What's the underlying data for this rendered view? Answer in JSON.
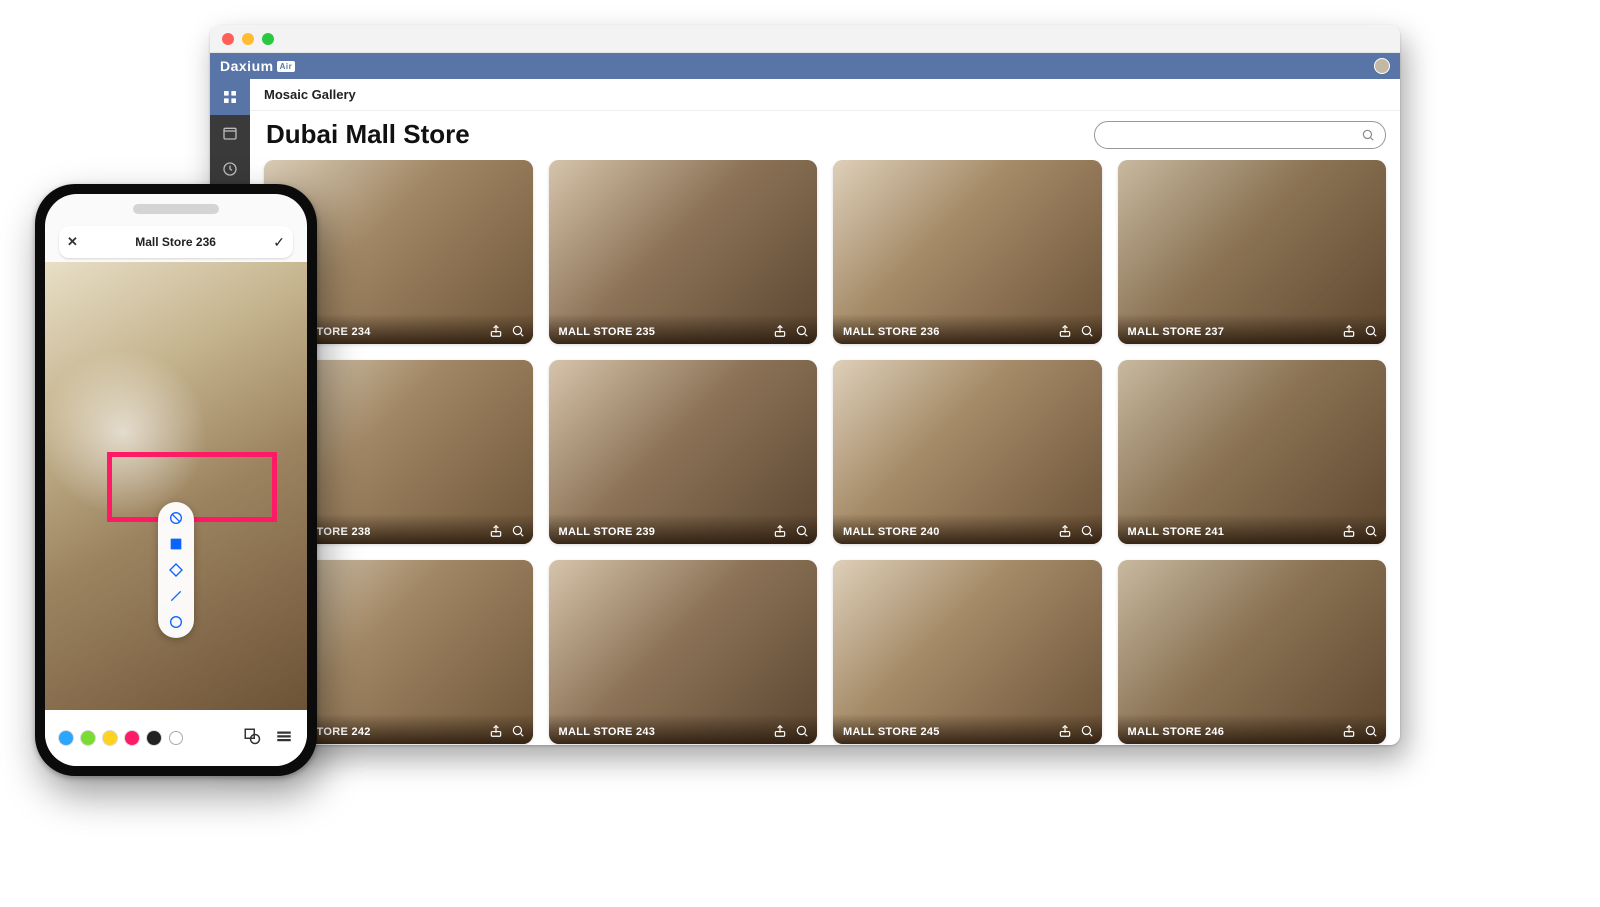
{
  "window": {
    "brand": "Daxium",
    "brand_suffix": "Air",
    "breadcrumb": "Mosaic Gallery",
    "page_title": "Dubai Mall Store"
  },
  "sidebar": {
    "items": [
      {
        "name": "apps-grid-icon",
        "active": true
      },
      {
        "name": "calendar-icon",
        "active": false
      },
      {
        "name": "clock-icon",
        "active": false
      }
    ]
  },
  "gallery": {
    "cards": [
      {
        "label": "MALL STORE 234"
      },
      {
        "label": "MALL STORE 235"
      },
      {
        "label": "MALL STORE 236"
      },
      {
        "label": "MALL STORE 237"
      },
      {
        "label": "MALL STORE 238"
      },
      {
        "label": "MALL STORE 239"
      },
      {
        "label": "MALL STORE 240"
      },
      {
        "label": "MALL STORE 241"
      },
      {
        "label": "MALL STORE 242"
      },
      {
        "label": "MALL STORE 243"
      },
      {
        "label": "MALL STORE 245"
      },
      {
        "label": "MALL STORE 246"
      }
    ]
  },
  "phone": {
    "title": "Mall Store 236",
    "tools": [
      {
        "name": "eraser-tool"
      },
      {
        "name": "rectangle-tool"
      },
      {
        "name": "diamond-tool"
      },
      {
        "name": "line-tool"
      },
      {
        "name": "circle-tool"
      }
    ],
    "colors": [
      {
        "hex": "#2aa6ff"
      },
      {
        "hex": "#7adc32"
      },
      {
        "hex": "#ffd21f"
      },
      {
        "hex": "#ff1a66"
      },
      {
        "hex": "#222222"
      },
      {
        "hex": "#ffffff"
      }
    ]
  }
}
